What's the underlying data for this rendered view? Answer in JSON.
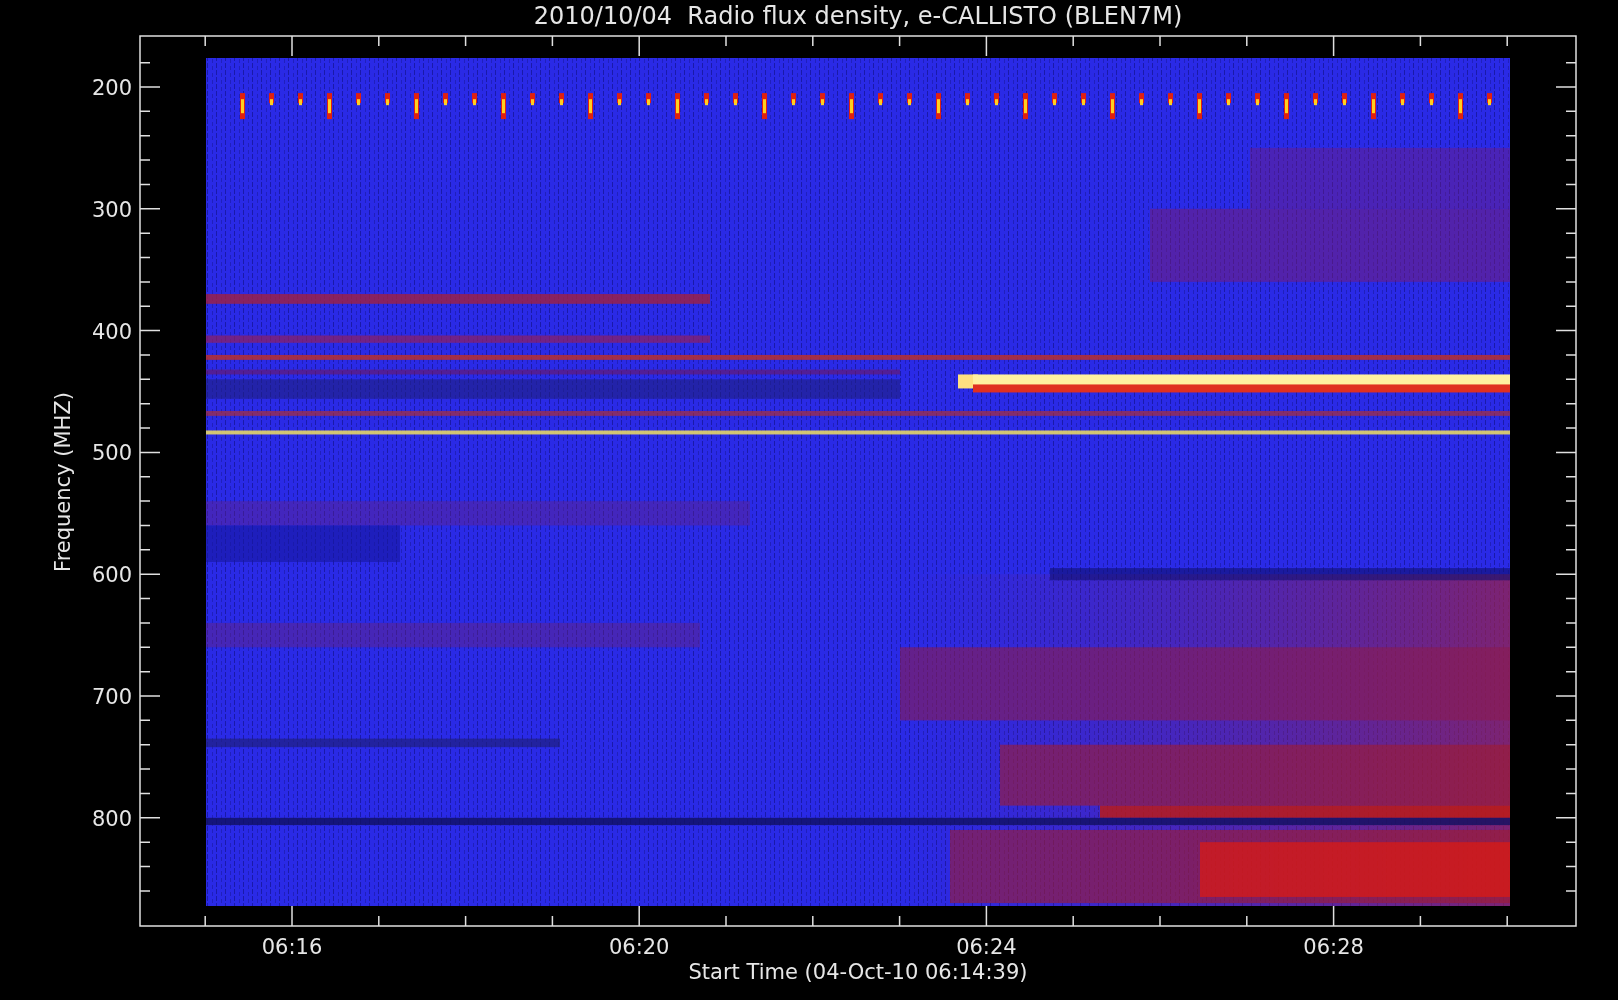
{
  "title": "2010/10/04  Radio flux density, e-CALLISTO (BLEN7M)",
  "ylabel": "Frequency (MHZ)",
  "xlabel": "Start Time (04-Oct-10 06:14:39)",
  "yticks": [
    "200",
    "300",
    "400",
    "500",
    "600",
    "700",
    "800"
  ],
  "xticks": [
    "06:16",
    "06:20",
    "06:24",
    "06:28"
  ]
}
